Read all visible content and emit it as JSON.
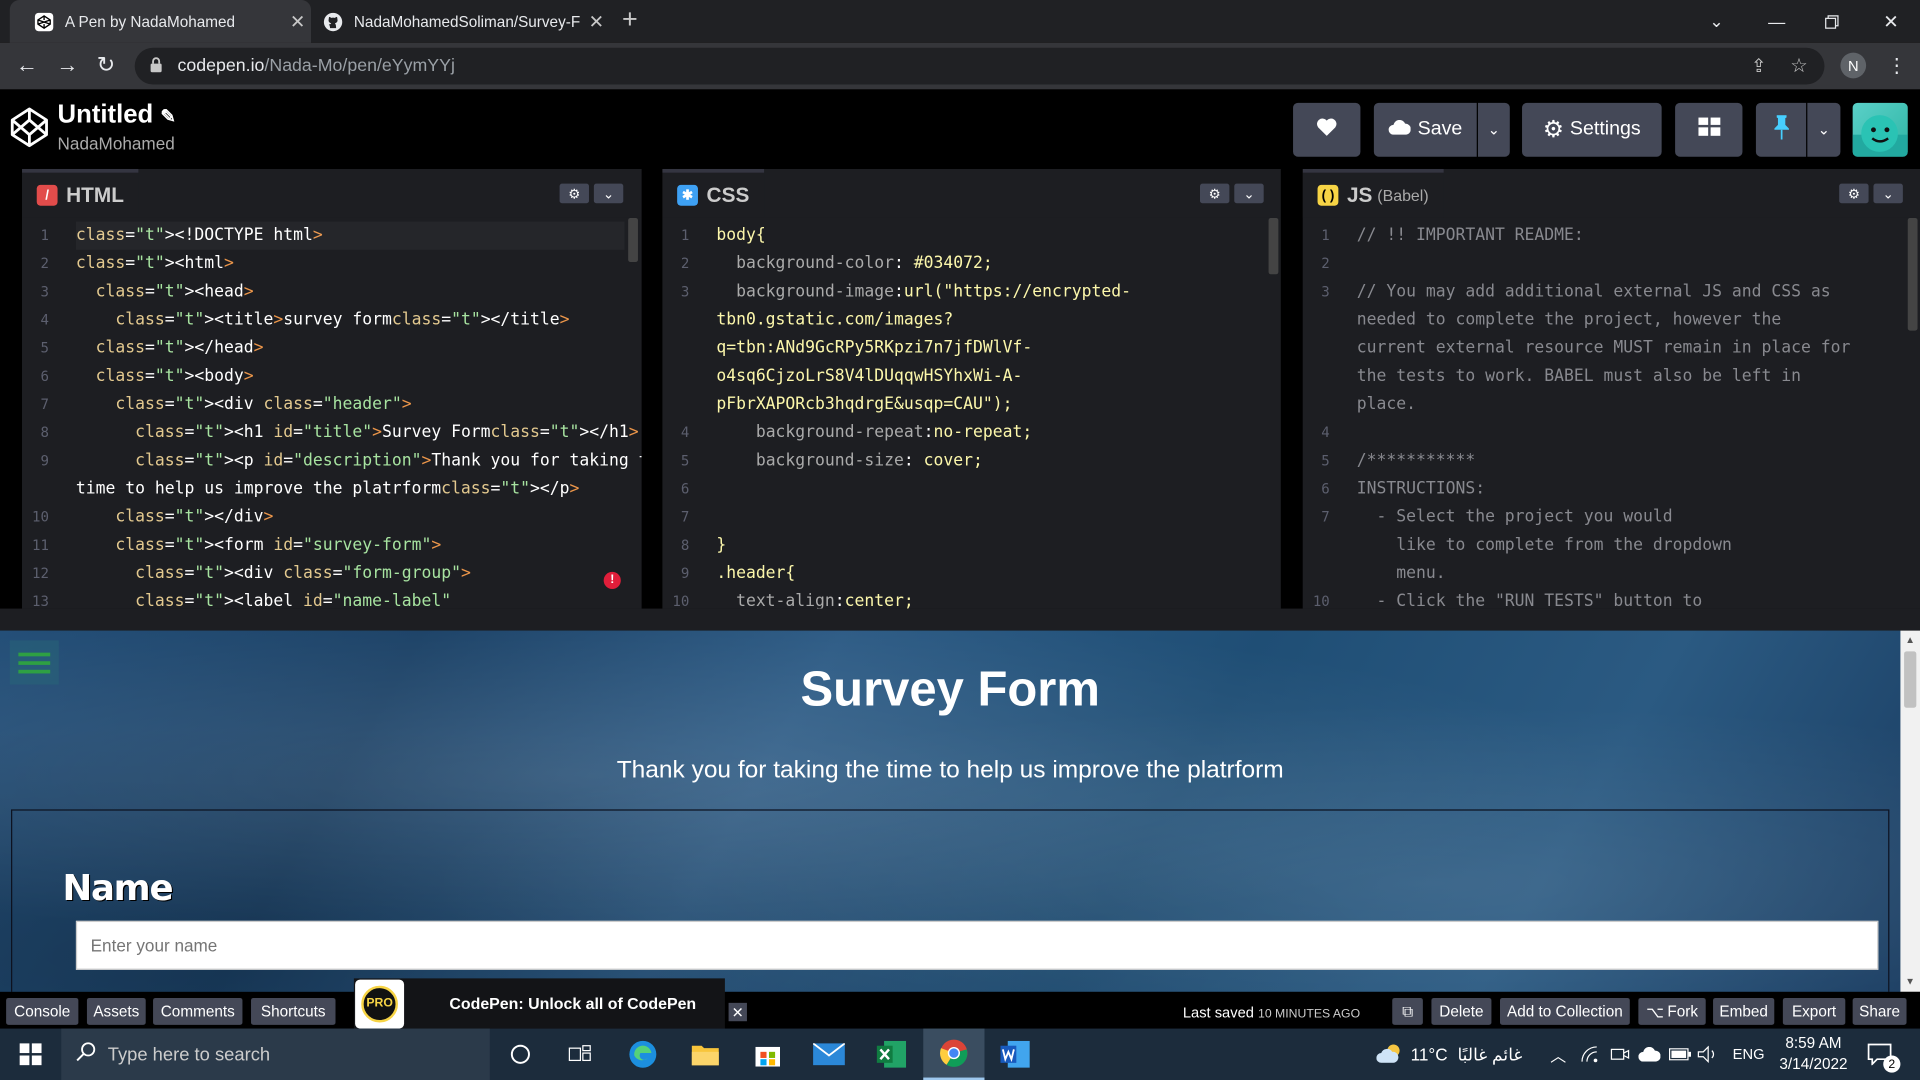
{
  "browser": {
    "tabs": [
      {
        "title": "A Pen by NadaMohamed",
        "active": true,
        "icon": "codepen-icon"
      },
      {
        "title": "NadaMohamedSoliman/Survey-F",
        "active": false,
        "icon": "github-icon"
      }
    ],
    "url_domain": "codepen.io",
    "url_path": "/Nada-Mo/pen/eYymYYj",
    "profile_initial": "N"
  },
  "codepen": {
    "title": "Untitled",
    "author": "NadaMohamed",
    "save_label": "Save",
    "settings_label": "Settings"
  },
  "editors": {
    "html": {
      "label": "HTML",
      "color": "#e24c4b"
    },
    "css": {
      "label": "CSS",
      "color": "#3ea1f4"
    },
    "js": {
      "label": "JS",
      "sub": "(Babel)",
      "color": "#f7d445"
    }
  },
  "html_code": [
    {
      "n": "1",
      "text": "<!DOCTYPE html>"
    },
    {
      "n": "2",
      "text": "<html>"
    },
    {
      "n": "3",
      "text": "  <head>"
    },
    {
      "n": "4",
      "text": "    <title>survey form</title>"
    },
    {
      "n": "5",
      "text": "  </head>"
    },
    {
      "n": "6",
      "text": "  <body>"
    },
    {
      "n": "7",
      "text": "    <div class=\"header\">"
    },
    {
      "n": "8",
      "text": "      <h1 id=\"title\">Survey Form</h1>"
    },
    {
      "n": "9",
      "text": "      <p id=\"description\">Thank you for taking the"
    },
    {
      "n": "",
      "text": "time to help us improve the platrform</p>"
    },
    {
      "n": "10",
      "text": "    </div>"
    },
    {
      "n": "11",
      "text": "    <form id=\"survey-form\">"
    },
    {
      "n": "12",
      "text": "      <div class=\"form-group\">"
    },
    {
      "n": "13",
      "text": "      <label id=\"name-label\""
    }
  ],
  "css_code": [
    {
      "n": "1",
      "text": "body{"
    },
    {
      "n": "2",
      "text": "  background-color: #034072;"
    },
    {
      "n": "3",
      "text": "  background-image:url(\"https://encrypted-"
    },
    {
      "n": "",
      "text": "tbn0.gstatic.com/images?"
    },
    {
      "n": "",
      "text": "q=tbn:ANd9GcRPy5RKpzi7n7jfDWlVf-"
    },
    {
      "n": "",
      "text": "o4sq6CjzoLrS8V4lDUqqwHSYhxWi-A-"
    },
    {
      "n": "",
      "text": "pFbrXAPORcb3hqdrgE&usqp=CAU\");"
    },
    {
      "n": "4",
      "text": "    background-repeat:no-repeat;"
    },
    {
      "n": "5",
      "text": "    background-size: cover;"
    },
    {
      "n": "6",
      "text": ""
    },
    {
      "n": "7",
      "text": ""
    },
    {
      "n": "8",
      "text": "}"
    },
    {
      "n": "9",
      "text": ".header{"
    },
    {
      "n": "10",
      "text": "  text-align:center;"
    }
  ],
  "js_code": [
    {
      "n": "1",
      "text": "// !! IMPORTANT README:"
    },
    {
      "n": "2",
      "text": ""
    },
    {
      "n": "3",
      "text": "// You may add additional external JS and CSS as"
    },
    {
      "n": "",
      "text": "needed to complete the project, however the"
    },
    {
      "n": "",
      "text": "current external resource MUST remain in place for"
    },
    {
      "n": "",
      "text": "the tests to work. BABEL must also be left in"
    },
    {
      "n": "",
      "text": "place."
    },
    {
      "n": "4",
      "text": ""
    },
    {
      "n": "5",
      "text": "/***********"
    },
    {
      "n": "6",
      "text": "INSTRUCTIONS:"
    },
    {
      "n": "7",
      "text": "  - Select the project you would"
    },
    {
      "n": "",
      "text": "    like to complete from the dropdown"
    },
    {
      "n": "",
      "text": "    menu."
    },
    {
      "n": "10",
      "text": "  - Click the \"RUN TESTS\" button to"
    }
  ],
  "preview": {
    "title": "Survey Form",
    "description": "Thank you for taking the time to help us improve the platrform",
    "name_label": "Name",
    "name_placeholder": "Enter your name"
  },
  "footer": {
    "console": "Console",
    "assets": "Assets",
    "comments": "Comments",
    "shortcuts": "Shortcuts",
    "pro_badge": "PRO",
    "pro_text": "CodePen: Unlock all of CodePen",
    "last_saved": "Last saved",
    "last_saved_when": "10 MINUTES AGO",
    "delete": "Delete",
    "add_to_collection": "Add to Collection",
    "fork": "Fork",
    "embed": "Embed",
    "export": "Export",
    "share": "Share"
  },
  "taskbar": {
    "search_placeholder": "Type here to search",
    "weather": "11°C",
    "weather_text": "غائم غالبًا",
    "lang": "ENG",
    "time": "8:59 AM",
    "date": "3/14/2022",
    "notif_count": "2"
  }
}
